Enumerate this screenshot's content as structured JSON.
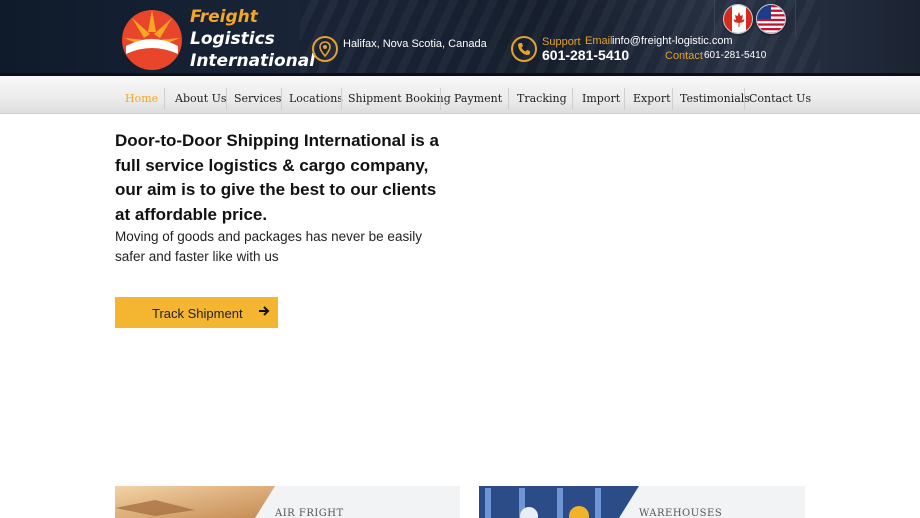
{
  "header": {
    "logo": {
      "line1": "Freight",
      "line2": "Logistics",
      "line3": "International"
    },
    "location": "Halifax, Nova Scotia, Canada",
    "support_label": "Support",
    "support_phone": "601-281-5410",
    "email_label": "Email",
    "email_value": "info@freight-logistic.com",
    "contact_label": "Contact",
    "contact_value": "601-281-5410",
    "flags": [
      "canada-flag-icon",
      "usa-flag-icon"
    ]
  },
  "nav": {
    "items": [
      {
        "label": "Home",
        "active": true
      },
      {
        "label": "About Us"
      },
      {
        "label": "Services"
      },
      {
        "label": "Locations"
      },
      {
        "label": "Shipment Booking"
      },
      {
        "label": "Payment"
      },
      {
        "label": "Tracking"
      },
      {
        "label": "Import"
      },
      {
        "label": "Export"
      },
      {
        "label": "Testimonials"
      },
      {
        "label": "Contact Us"
      }
    ]
  },
  "hero": {
    "title": "Door-to-Door Shipping International  is a full service logistics & cargo company, our aim is to give the best to our  clients at affordable price.",
    "subtitle": "Moving of goods and packages has never be easily safer and faster like with us",
    "button_label": "Track Shipment"
  },
  "cards": [
    {
      "label": "AIR FRIGHT"
    },
    {
      "label": "WAREHOUSES"
    }
  ],
  "colors": {
    "accent": "#f5a623",
    "button": "#f4b531",
    "header_bg": "#17202f"
  }
}
